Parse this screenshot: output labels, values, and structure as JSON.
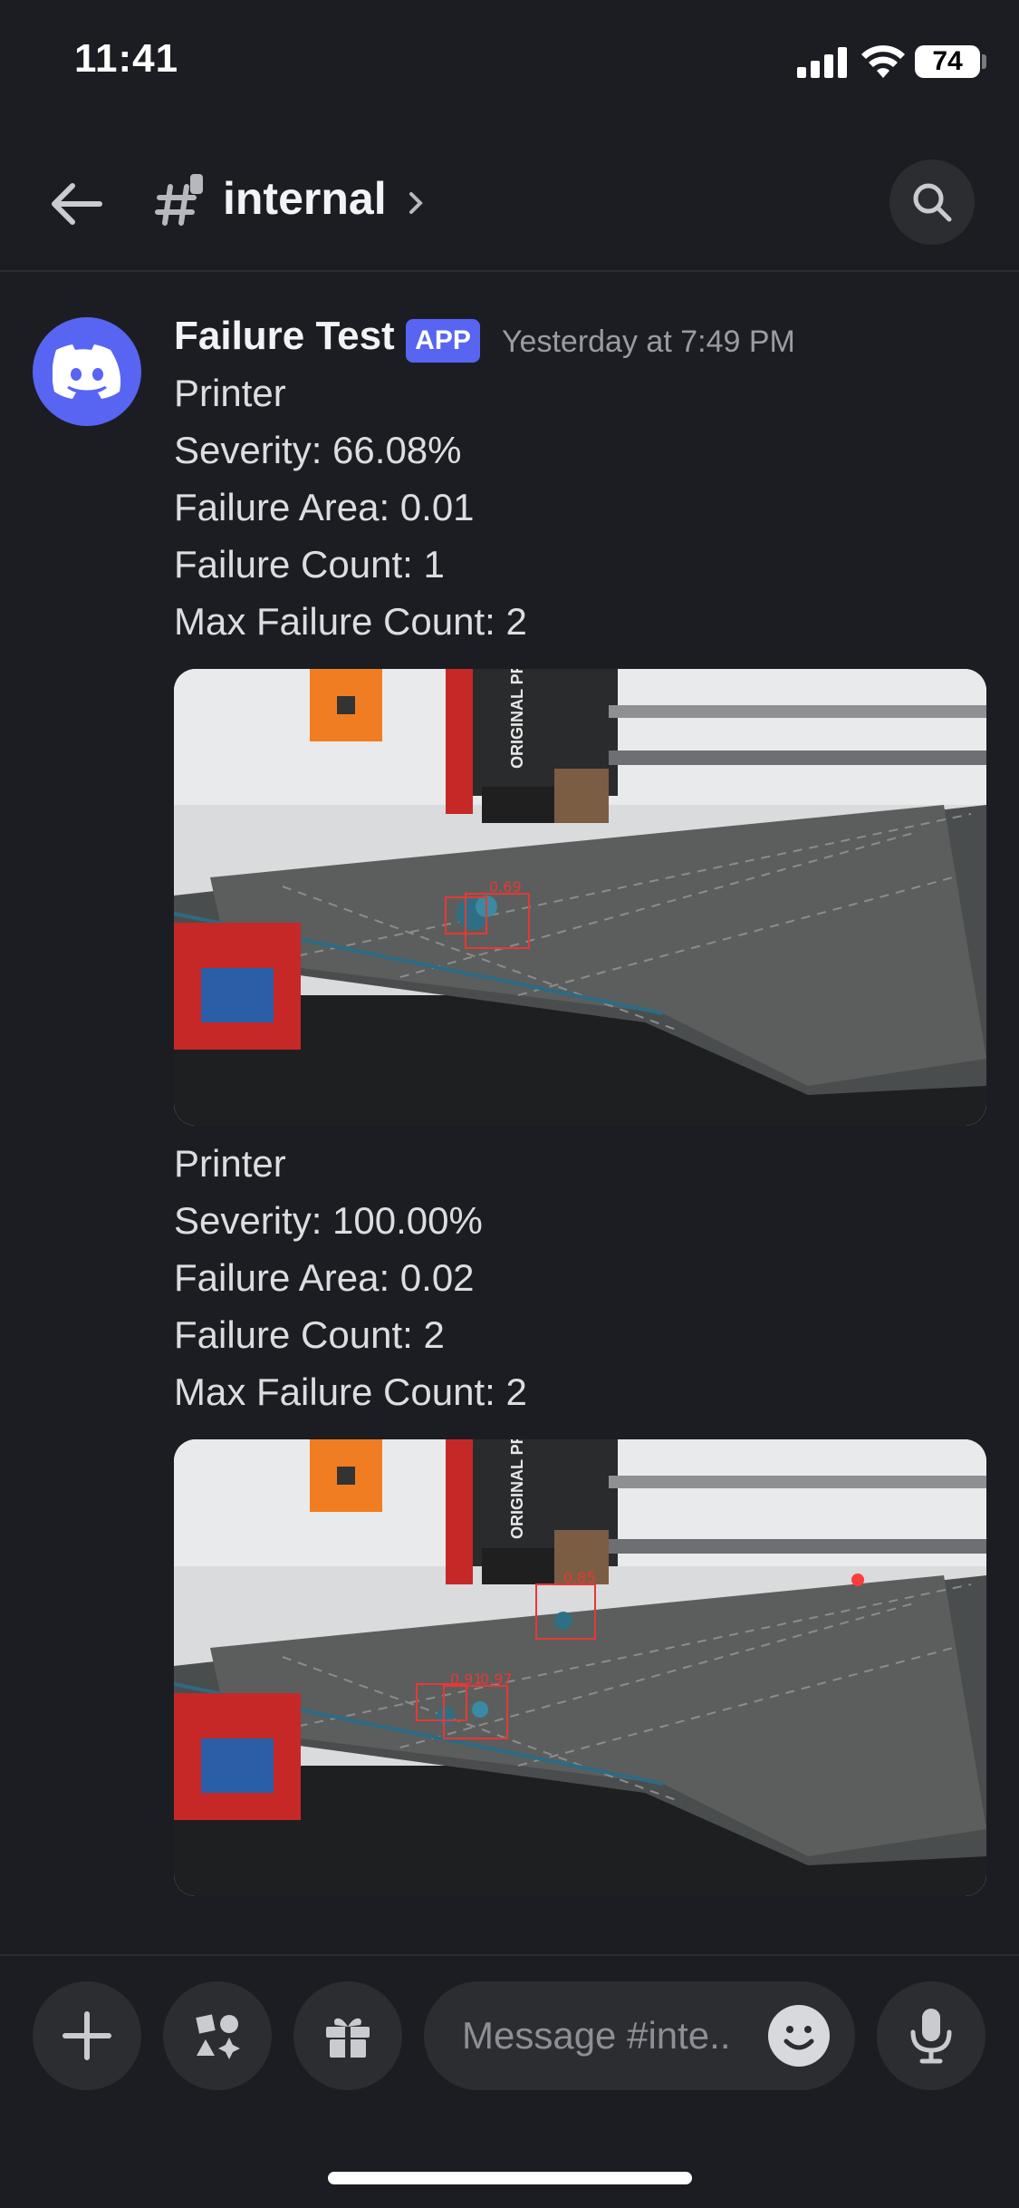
{
  "status_bar": {
    "time": "11:41",
    "battery": "74"
  },
  "header": {
    "channel": "internal"
  },
  "message": {
    "author": "Failure Test",
    "badge": "APP",
    "timestamp": "Yesterday at 7:49 PM",
    "reports": [
      {
        "printer": "Printer",
        "severity": "Severity: 66.08%",
        "area": "Failure Area: 0.01",
        "count": "Failure Count: 1",
        "max_count": "Max Failure Count: 2",
        "image": {
          "printer_label": "ORIGINAL PRUSA MINI",
          "detection_label": "0.69"
        }
      },
      {
        "printer": "Printer",
        "severity": "Severity: 100.00%",
        "area": "Failure Area: 0.02",
        "count": "Failure Count: 2",
        "max_count": "Max Failure Count: 2",
        "image": {
          "printer_label": "ORIGINAL PRUSA MINI",
          "detection_label_a": "0.91",
          "detection_label_b": "0.97",
          "detection_label_c": "0.85"
        }
      }
    ]
  },
  "composer": {
    "placeholder": "Message #inte.."
  },
  "colors": {
    "accent": "#5865f2",
    "background": "#1c1d22",
    "detection": "#e53935"
  },
  "icons": [
    "back-arrow-icon",
    "hash-icon",
    "chevron-right-icon",
    "search-icon",
    "discord-logo-icon",
    "plus-icon",
    "apps-icon",
    "gift-icon",
    "emoji-icon",
    "microphone-icon"
  ]
}
